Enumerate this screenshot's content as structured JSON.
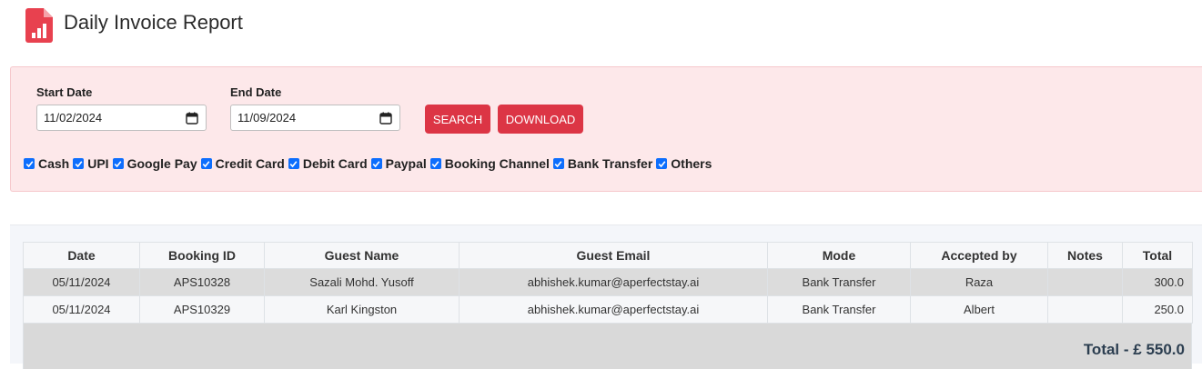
{
  "header": {
    "title": "Daily Invoice Report",
    "icon": "report-document-icon"
  },
  "filters": {
    "start_date": {
      "label": "Start Date",
      "value": "11/02/2024"
    },
    "end_date": {
      "label": "End Date",
      "value": "11/09/2024"
    },
    "search_label": "SEARCH",
    "download_label": "DOWNLOAD",
    "payment_methods": [
      {
        "label": "Cash",
        "checked": true
      },
      {
        "label": "UPI",
        "checked": true
      },
      {
        "label": "Google Pay",
        "checked": true
      },
      {
        "label": "Credit Card",
        "checked": true
      },
      {
        "label": "Debit Card",
        "checked": true
      },
      {
        "label": "Paypal",
        "checked": true
      },
      {
        "label": "Booking Channel",
        "checked": true
      },
      {
        "label": "Bank Transfer",
        "checked": true
      },
      {
        "label": "Others",
        "checked": true
      }
    ]
  },
  "table": {
    "columns": [
      "Date",
      "Booking ID",
      "Guest Name",
      "Guest Email",
      "Mode",
      "Accepted by",
      "Notes",
      "Total"
    ],
    "rows": [
      [
        "05/11/2024",
        "APS10328",
        "Sazali Mohd. Yusoff",
        "abhishek.kumar@aperfectstay.ai",
        "Bank Transfer",
        "Raza",
        "",
        "300.0"
      ],
      [
        "05/11/2024",
        "APS10329",
        "Karl Kingston",
        "abhishek.kumar@aperfectstay.ai",
        "Bank Transfer",
        "Albert",
        "",
        "250.0"
      ]
    ],
    "total_label": "Total - £ 550.0"
  },
  "colors": {
    "accent": "#dc3545",
    "panel_bg": "#fde8ea",
    "checkbox": "#0d6efd",
    "icon": "#e8414f"
  }
}
